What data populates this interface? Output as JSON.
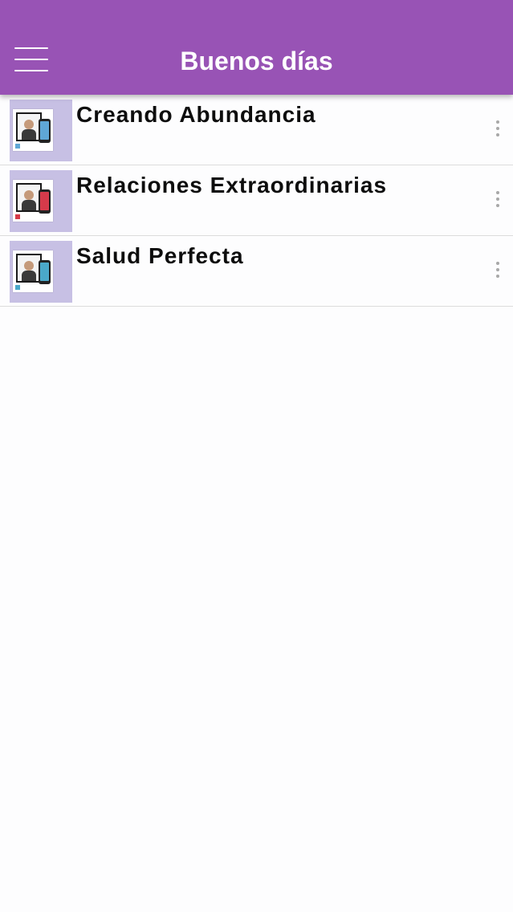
{
  "header": {
    "title": "Buenos días",
    "menu_icon": "hamburger-menu-icon",
    "background_color": "#9853b5"
  },
  "list": {
    "items": [
      {
        "title": "Creando Abundancia",
        "thumbnail_icon": "book-cover-thumbnail",
        "more_icon": "more-vertical-icon",
        "accent": "#5fa7d6"
      },
      {
        "title": "Relaciones Extraordinarias",
        "thumbnail_icon": "book-cover-thumbnail",
        "more_icon": "more-vertical-icon",
        "accent": "#d63a4a"
      },
      {
        "title": "Salud Perfecta",
        "thumbnail_icon": "book-cover-thumbnail",
        "more_icon": "more-vertical-icon",
        "accent": "#4aa8c9"
      }
    ]
  },
  "colors": {
    "thumbnail_background": "#c7c0e4",
    "divider": "#dcdcdc",
    "page_background": "#fdfdfe"
  }
}
